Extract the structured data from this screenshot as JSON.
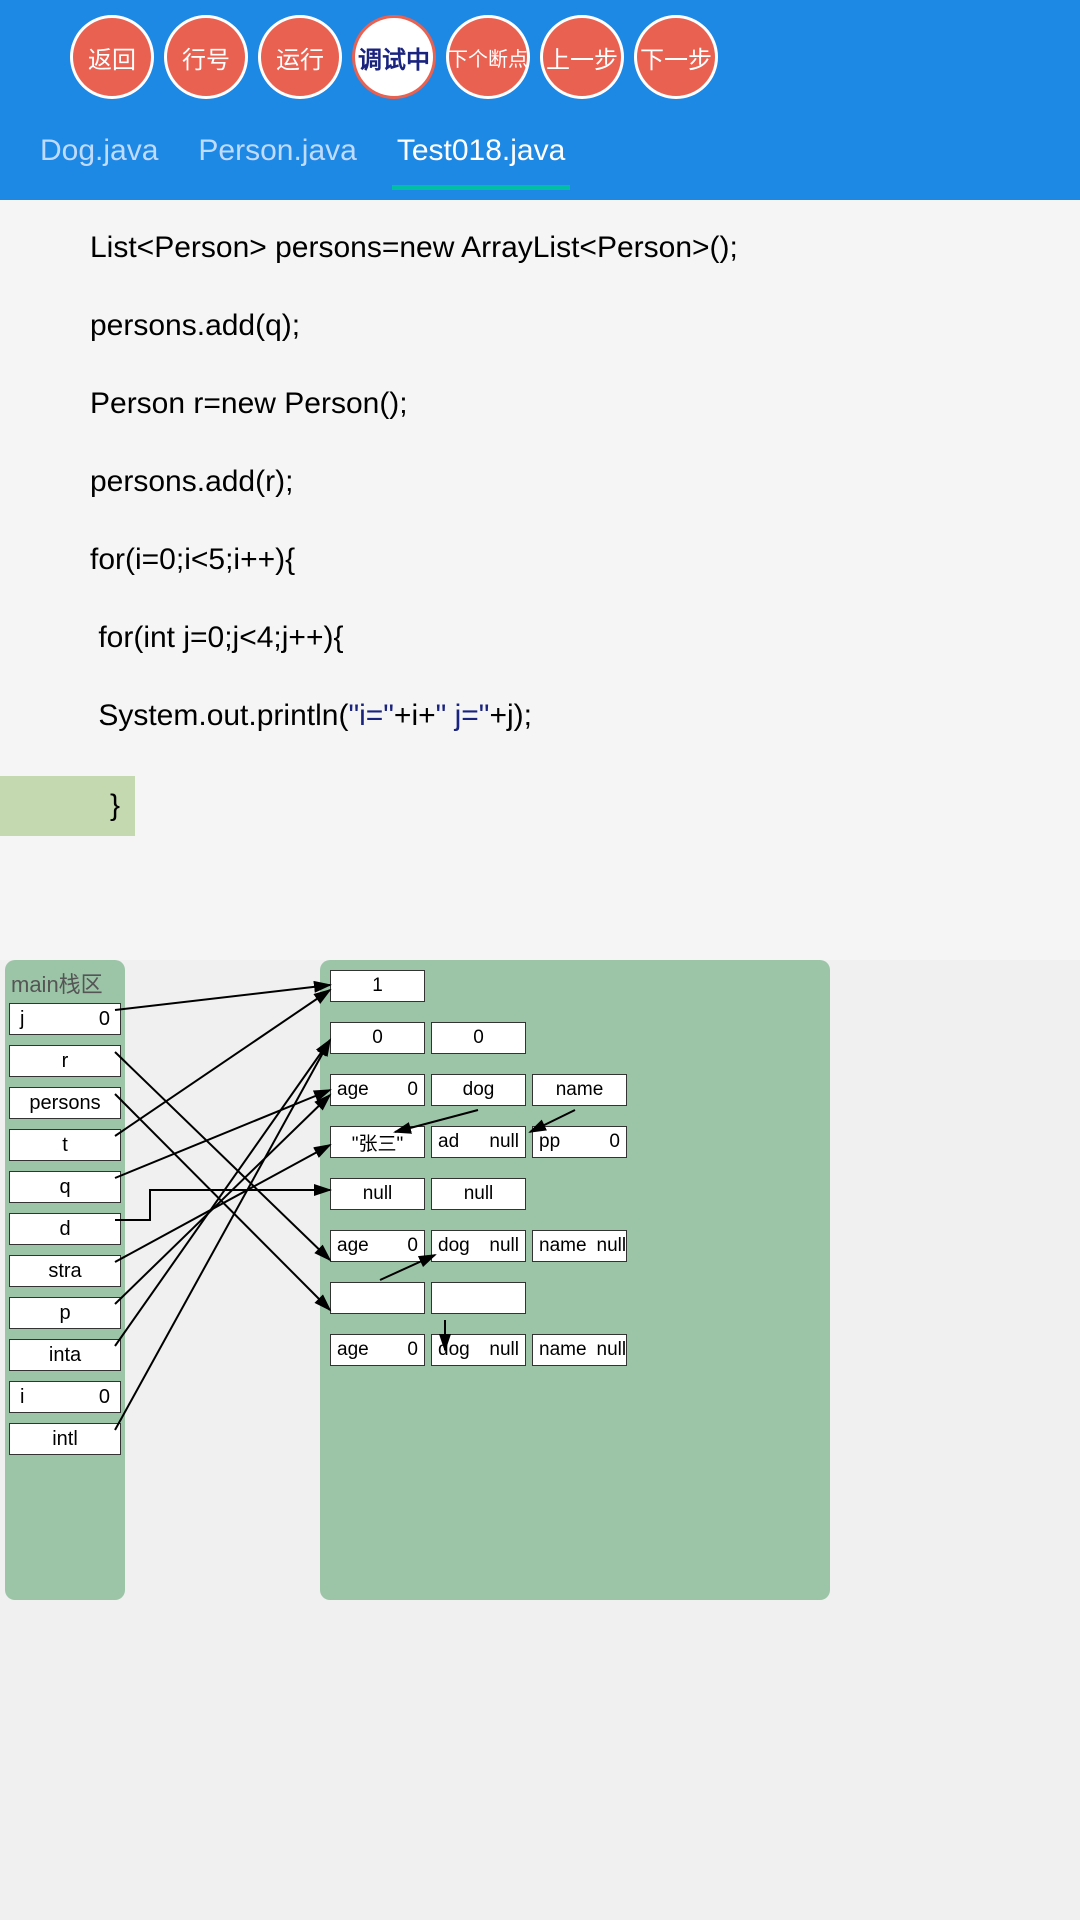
{
  "toolbar": {
    "back": "返回",
    "line_no": "行号",
    "run": "运行",
    "debug": "调试中",
    "next_bp": "下个断点",
    "prev_step": "上一步",
    "next_step": "下一步"
  },
  "tabs": {
    "items": [
      {
        "label": "Dog.java",
        "active": false
      },
      {
        "label": "Person.java",
        "active": false
      },
      {
        "label": "Test018.java",
        "active": true
      }
    ]
  },
  "code": {
    "lines": [
      {
        "text": "List<Person> persons=new ArrayList<Person>();",
        "indent": 0
      },
      {
        "text": "persons.add(q);",
        "indent": 0
      },
      {
        "text": "Person r=new Person();",
        "indent": 0
      },
      {
        "text": "persons.add(r);",
        "indent": 0
      },
      {
        "text": "for(i=0;i<5;i++){",
        "indent": 0
      },
      {
        "text": " for(int j=0;j<4;j++){",
        "indent": 0
      },
      {
        "pre": " System.out.println(",
        "str1": "\"i=\"",
        "mid": "+i+",
        "str2": "\" j=\"",
        "post": "+j);",
        "indent": 0,
        "special": true
      },
      {
        "text": "}",
        "highlight": true
      }
    ]
  },
  "stack": {
    "title": "main栈区",
    "items": [
      {
        "name": "j",
        "value": "0"
      },
      {
        "name": "r"
      },
      {
        "name": "persons"
      },
      {
        "name": "t"
      },
      {
        "name": "q"
      },
      {
        "name": "d"
      },
      {
        "name": "stra"
      },
      {
        "name": "p"
      },
      {
        "name": "inta"
      },
      {
        "name": "i",
        "value": "0"
      },
      {
        "name": "intl"
      }
    ]
  },
  "heap": {
    "rows": [
      [
        {
          "v": "1"
        }
      ],
      [
        {
          "v": "0"
        },
        {
          "v": "0"
        }
      ],
      [
        {
          "k": "age",
          "v": "0"
        },
        {
          "k": "dog"
        },
        {
          "k": "name"
        }
      ],
      [
        {
          "v": "\"张三\""
        },
        {
          "k": "ad",
          "v": "null"
        },
        {
          "k": "pp",
          "v": "0"
        }
      ],
      [
        {
          "v": "null"
        },
        {
          "v": "null"
        }
      ],
      [
        {
          "k": "age",
          "v": "0"
        },
        {
          "k": "dog",
          "v": "null"
        },
        {
          "k": "name",
          "v": "null"
        }
      ],
      [
        {
          "empty": true
        },
        {
          "empty": true
        }
      ],
      [
        {
          "k": "age",
          "v": "0"
        },
        {
          "k": "dog",
          "v": "null"
        },
        {
          "k": "name",
          "v": "null"
        }
      ]
    ]
  }
}
